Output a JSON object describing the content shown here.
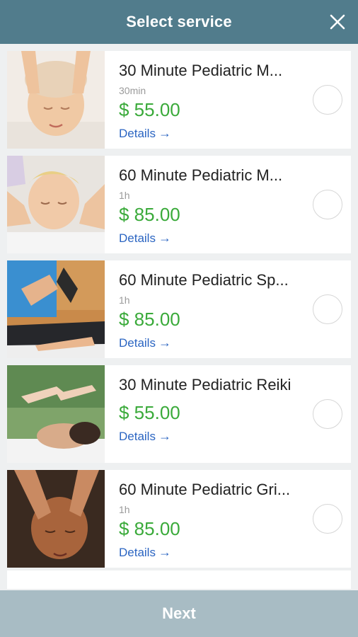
{
  "header": {
    "title": "Select service"
  },
  "services": [
    {
      "name": "30 Minute Pediatric M...",
      "duration": "30min",
      "price": "$ 55.00",
      "details": "Details"
    },
    {
      "name": "60 Minute Pediatric M...",
      "duration": "1h",
      "price": "$ 85.00",
      "details": "Details"
    },
    {
      "name": "60 Minute Pediatric Sp...",
      "duration": "1h",
      "price": "$ 85.00",
      "details": "Details"
    },
    {
      "name": "30 Minute Pediatric Reiki",
      "duration": "",
      "price": "$ 55.00",
      "details": "Details"
    },
    {
      "name": "60 Minute Pediatric Gri...",
      "duration": "1h",
      "price": "$ 85.00",
      "details": "Details"
    }
  ],
  "footer": {
    "next_label": "Next"
  },
  "colors": {
    "header_bg": "#517c8c",
    "price": "#3aaa3a",
    "link": "#2b65c2",
    "footer_bg": "#a8bcc4"
  },
  "icons": {
    "close": "close-icon",
    "details_arrow": "arrow-right-icon"
  }
}
